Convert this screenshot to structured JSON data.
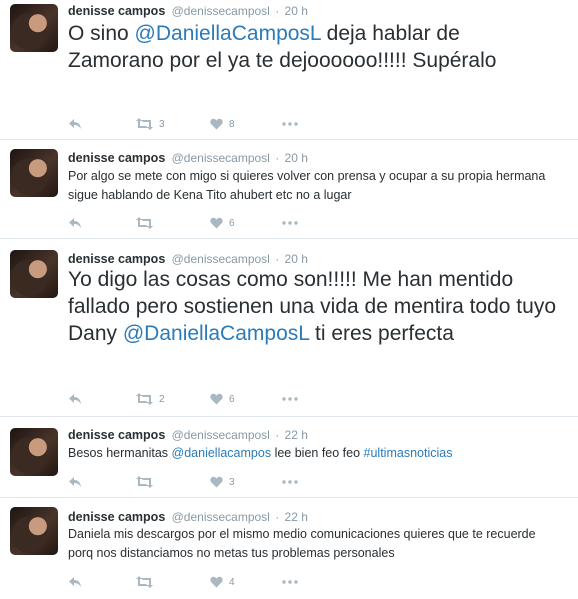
{
  "tweets": [
    {
      "name": "denisse campos",
      "handle": "@denissecamposl",
      "time": "20 h",
      "segments": [
        {
          "t": "O sino "
        },
        {
          "t": "@DaniellaCamposL",
          "cls": "mention"
        },
        {
          "t": " deja hablar de Zamorano por el ya te dejoooooo!!!!! Supéralo"
        }
      ],
      "retweets": "3",
      "likes": "8"
    },
    {
      "name": "denisse campos",
      "handle": "@denissecamposl",
      "time": "20 h",
      "segments": [
        {
          "t": "Por algo se mete con migo si quieres volver con prensa y ocupar a su propia hermana sigue hablando de Kena Tito ahubert etc no a lugar"
        }
      ],
      "retweets": "",
      "likes": "6"
    },
    {
      "name": "denisse campos",
      "handle": "@denissecamposl",
      "time": "20 h",
      "segments": [
        {
          "t": "Yo digo las cosas como son!!!!! Me han mentido fallado pero sostienen una vida de mentira todo tuyo Dany "
        },
        {
          "t": "@DaniellaCamposL",
          "cls": "mention"
        },
        {
          "t": " ti eres perfecta"
        }
      ],
      "retweets": "2",
      "likes": "6"
    },
    {
      "name": "denisse campos",
      "handle": "@denissecamposl",
      "time": "22 h",
      "segments": [
        {
          "t": "Besos hermanitas "
        },
        {
          "t": "@daniellacampos",
          "cls": "mention"
        },
        {
          "t": " lee bien feo feo "
        },
        {
          "t": "#ultimasnoticias",
          "cls": "hashtag"
        }
      ],
      "retweets": "",
      "likes": "3"
    },
    {
      "name": "denisse campos",
      "handle": "@denissecamposl",
      "time": "22 h",
      "segments": [
        {
          "t": "Daniela mis descargos por el mismo medio comunicaciones quieres que te recuerde porq nos distanciamos no metas tus problemas personales"
        }
      ],
      "retweets": "",
      "likes": "4"
    }
  ],
  "separator": "·",
  "icons": {
    "reply": "reply-icon",
    "retweet": "retweet-icon",
    "like": "heart-icon",
    "more": "more-icon"
  },
  "colors": {
    "link": "#2b7bb9",
    "text": "#292f33",
    "muted": "#8899a6",
    "icon": "#aab8c2"
  }
}
